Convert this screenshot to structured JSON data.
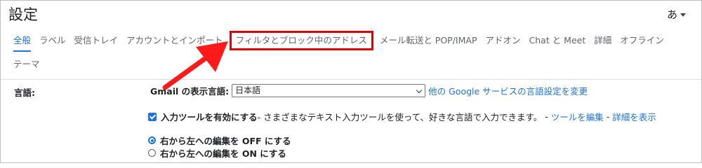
{
  "header": {
    "title": "設定",
    "ime_label": "あ"
  },
  "tabs": [
    {
      "label": "全般",
      "state": "active"
    },
    {
      "label": "ラベル"
    },
    {
      "label": "受信トレイ"
    },
    {
      "label": "アカウントとインポート"
    },
    {
      "label": "フィルタとブロック中のアドレス",
      "state": "highlighted"
    },
    {
      "label": "メール転送と POP/IMAP"
    },
    {
      "label": "アドオン"
    },
    {
      "label": "Chat と Meet"
    },
    {
      "label": "詳細"
    },
    {
      "label": "オフライン"
    },
    {
      "label": "テーマ"
    }
  ],
  "language_section": {
    "label": "言語:",
    "display_language_label": "Gmail の表示言語:",
    "selected_language": "日本語",
    "other_settings_link": "他の Google サービスの言語設定を変更",
    "input_tools": {
      "checked": true,
      "label": "入力ツールを有効にする",
      "description": " - さまざまなテキスト入力ツールを使って、好きな言語で入力できます。",
      "sep1": " - ",
      "edit_link": "ツールを編集",
      "sep2": " - ",
      "details_link": "詳細を表示"
    },
    "rtl_options": [
      {
        "label": "右から左への編集を OFF にする",
        "selected": true
      },
      {
        "label": "右から左への編集を ON にする",
        "selected": false
      }
    ]
  },
  "colors": {
    "accent": "#1a73e8",
    "highlight_box": "#e00000",
    "arrow": "#ff1a1a"
  },
  "annotation": {
    "arrow_icon": "red-arrow-pointer"
  }
}
